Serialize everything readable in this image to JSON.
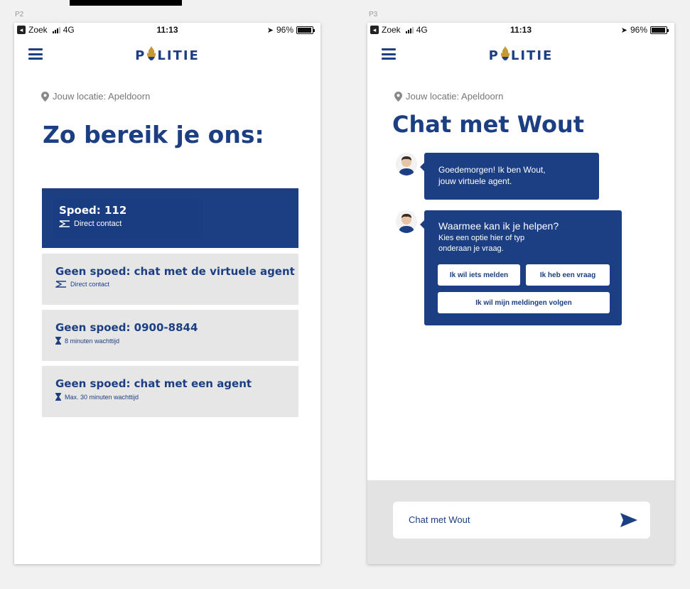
{
  "labels": {
    "p2": "P2",
    "p3": "P3"
  },
  "colors": {
    "brand": "#1c3f84",
    "gold": "#c59a35",
    "light_card": "#e6e6e6",
    "page_bg": "#f1f1f1"
  },
  "status": {
    "carrier": "Zoek",
    "network": "4G",
    "time": "11:13",
    "battery": "96%"
  },
  "brand": {
    "logo_p": "P",
    "logo_rest": "LITIE"
  },
  "p2": {
    "location": "Jouw locatie: Apeldoorn",
    "title": "Zo bereik je ons:",
    "options": [
      {
        "title": "Spoed: 112",
        "sub": "Direct contact",
        "icon": "sigma-icon"
      },
      {
        "title": "Geen spoed: chat met de virtuele agent",
        "sub": "Direct contact",
        "icon": "sigma-icon"
      },
      {
        "title": "Geen spoed: 0900-8844",
        "sub": "8 minuten wachttijd",
        "icon": "hourglass-icon"
      },
      {
        "title": "Geen spoed: chat met een agent",
        "sub": "Max. 30 minuten wachttijd",
        "icon": "hourglass-icon"
      }
    ]
  },
  "p3": {
    "location": "Jouw locatie: Apeldoorn",
    "title": "Chat met Wout",
    "msg1": {
      "line1": "Goedemorgen! Ik ben Wout,",
      "line2": "jouw virtuele agent."
    },
    "msg2": {
      "question": "Waarmee kan ik je helpen?",
      "hint_line1": "Kies een optie hier of typ",
      "hint_line2": "onderaan je vraag.",
      "buttons": [
        "Ik wil iets melden",
        "Ik heb een vraag",
        "Ik wil mijn meldingen volgen"
      ]
    },
    "input_placeholder": "Chat met Wout"
  }
}
